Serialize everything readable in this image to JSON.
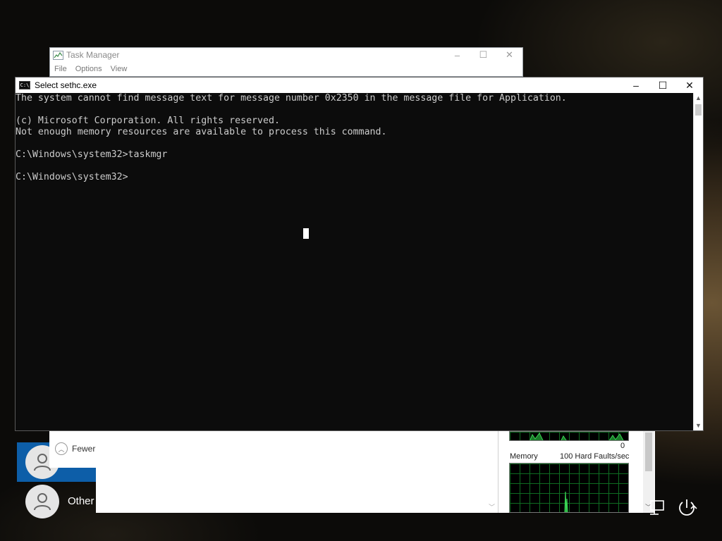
{
  "task_manager": {
    "title": "Task Manager",
    "menu": [
      "File",
      "Options",
      "View"
    ],
    "fewer_details_label": "Fewer",
    "graph_scale_label": "0",
    "memory_label": "Memory",
    "hard_faults_label": "100 Hard Faults/sec",
    "controls": {
      "minimize": "–",
      "maximize": "☐",
      "close": "✕"
    }
  },
  "cmd": {
    "title": "Select sethc.exe",
    "icon_label": "C:\\",
    "lines": [
      "The system cannot find message text for message number 0x2350 in the message file for Application.",
      "",
      "(c) Microsoft Corporation. All rights reserved.",
      "Not enough memory resources are available to process this command.",
      "",
      "C:\\Windows\\system32>taskmgr",
      "",
      "C:\\Windows\\system32>"
    ],
    "controls": {
      "minimize": "–",
      "maximize": "☐",
      "close": "✕"
    },
    "background_color": "#0c0c0c",
    "text_color": "#cccccc"
  },
  "lock_screen": {
    "other_user_label": "Other",
    "selected_tile_color": "#0d5ea8",
    "icons": [
      "network-icon",
      "power-icon"
    ]
  }
}
